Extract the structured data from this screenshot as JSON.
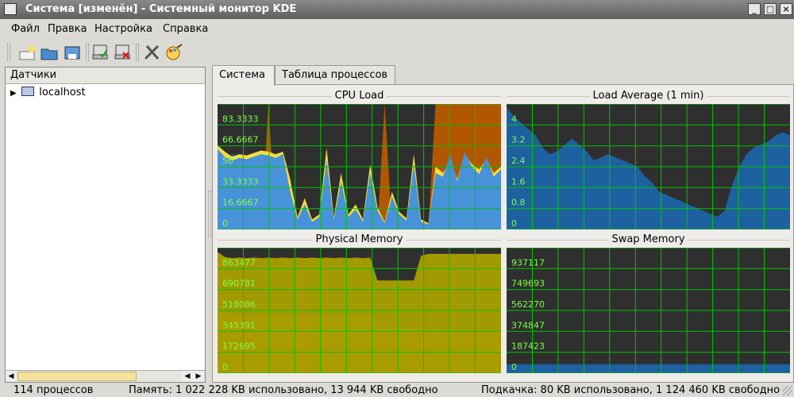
{
  "window": {
    "title": "Система [изменён] - Системный монитор KDE"
  },
  "menu": [
    "Файл",
    "Правка",
    "Настройка",
    "Справка"
  ],
  "toolbar_icons": [
    "new-sheet-icon",
    "open-icon",
    "save-icon",
    "connect-host-icon",
    "disconnect-host-icon",
    "configure-icon",
    "color-scheme-icon"
  ],
  "sidebar": {
    "header": "Датчики",
    "tree": [
      {
        "label": "localhost"
      }
    ]
  },
  "tabs": [
    "Система",
    "Таблица процессов"
  ],
  "colors": {
    "plot_bg": "#2f2f2f",
    "grid": "#00c400",
    "label": "#7dff44",
    "blue": "#1d64a8",
    "orange": "#b85a00",
    "olive": "#a8a000",
    "yellow": "#ffe63a",
    "lightblue": "#3d8de0"
  },
  "chart_data": [
    {
      "type": "area",
      "title": "CPU Load",
      "tick_labels": [
        "83.3333",
        "66.6667",
        "50",
        "33.3333",
        "16.6667",
        "0"
      ],
      "ylim": [
        0,
        100
      ],
      "grid": true,
      "series": [
        {
          "color": "#1d64a8",
          "values": [
            60,
            56,
            60,
            58,
            57,
            59,
            60,
            60,
            58,
            60,
            5,
            4,
            4,
            4,
            3,
            4,
            5,
            4,
            3,
            4,
            4,
            4,
            5,
            4,
            3,
            4,
            3,
            4,
            3,
            4,
            35,
            33,
            38,
            36,
            40,
            37,
            38,
            34,
            36,
            35
          ]
        },
        {
          "color": "#b85a00",
          "values": [
            0,
            0,
            0,
            0,
            0,
            0,
            0,
            100,
            0,
            0,
            0,
            0,
            0,
            0,
            0,
            0,
            0,
            0,
            0,
            0,
            0,
            0,
            0,
            100,
            0,
            0,
            0,
            0,
            0,
            0,
            100,
            100,
            100,
            100,
            100,
            100,
            100,
            100,
            100,
            100
          ]
        },
        {
          "color": "#ffe63a",
          "values": [
            67,
            62,
            58,
            60,
            59,
            61,
            63,
            62,
            60,
            62,
            40,
            10,
            25,
            8,
            12,
            65,
            10,
            45,
            12,
            20,
            8,
            52,
            18,
            6,
            30,
            14,
            9,
            60,
            8,
            5,
            50,
            45,
            55,
            40,
            60,
            52,
            48,
            56,
            45,
            50
          ]
        },
        {
          "color": "#3d8de0",
          "values": [
            64,
            58,
            55,
            57,
            56,
            58,
            60,
            59,
            57,
            60,
            30,
            8,
            20,
            6,
            10,
            55,
            8,
            38,
            10,
            16,
            6,
            45,
            15,
            5,
            26,
            12,
            7,
            52,
            6,
            4,
            45,
            42,
            60,
            38,
            62,
            50,
            44,
            58,
            42,
            48
          ]
        }
      ]
    },
    {
      "type": "area",
      "title": "Load Average (1 min)",
      "tick_labels": [
        "4",
        "3.2",
        "2.4",
        "1.6",
        "0.8",
        "0"
      ],
      "ylim": [
        0,
        4
      ],
      "grid": true,
      "series": [
        {
          "color": "#1d64a8",
          "values": [
            3.9,
            3.6,
            3.4,
            3.2,
            3.0,
            2.6,
            2.4,
            2.5,
            2.7,
            2.9,
            2.7,
            2.5,
            2.2,
            2.3,
            2.4,
            2.3,
            2.2,
            2.1,
            2.0,
            1.7,
            1.5,
            1.2,
            1.1,
            1.0,
            0.9,
            0.8,
            0.7,
            0.6,
            0.5,
            0.4,
            0.6,
            1.4,
            2.0,
            2.4,
            2.6,
            2.7,
            2.8,
            3.0,
            3.1,
            3.0
          ]
        }
      ]
    },
    {
      "type": "area",
      "title": "Physical Memory",
      "tick_labels": [
        "863477",
        "690781",
        "518086",
        "345391",
        "172695",
        "0"
      ],
      "ylim": [
        0,
        1036173
      ],
      "grid": true,
      "series": [
        {
          "color": "#1d64a8",
          "values": [
            200000,
            195000,
            190000,
            185000,
            180000,
            178000,
            176000,
            175000,
            174000,
            173000,
            172000,
            172000,
            171000,
            171000,
            170000,
            170000,
            170000,
            169000,
            169000,
            168000,
            168000,
            168000,
            167000,
            167000,
            167000,
            166000,
            166000,
            166000,
            165000,
            165000,
            165000,
            165000,
            165000,
            164000,
            164000,
            164000,
            164000,
            164000,
            164000,
            164000
          ]
        },
        {
          "color": "#b85a00",
          "values": [
            500000,
            495000,
            490000,
            485000,
            480000,
            478000,
            476000,
            475000,
            474000,
            473000,
            472000,
            471000,
            470000,
            469000,
            468000,
            467000,
            466000,
            465000,
            464000,
            463000,
            462000,
            480000,
            385000,
            380000,
            378000,
            376000,
            374000,
            372000,
            380000,
            375000,
            370000,
            368000,
            366000,
            365000,
            364000,
            363000,
            362000,
            361000,
            360000,
            359000
          ]
        },
        {
          "color": "#a8a000",
          "values": [
            1000000,
            960000,
            950000,
            955000,
            950000,
            955000,
            950000,
            955000,
            950000,
            955000,
            950000,
            955000,
            950000,
            955000,
            950000,
            955000,
            950000,
            955000,
            950000,
            955000,
            950000,
            955000,
            765000,
            765000,
            765000,
            765000,
            765000,
            765000,
            970000,
            985000,
            985000,
            985000,
            985000,
            985000,
            985000,
            985000,
            985000,
            985000,
            985000,
            985000
          ]
        }
      ]
    },
    {
      "type": "area",
      "title": "Swap Memory",
      "tick_labels": [
        "937117",
        "749693",
        "562270",
        "374847",
        "187423",
        "0"
      ],
      "ylim": [
        0,
        1124540
      ],
      "grid": true,
      "series": [
        {
          "color": "#1d64a8",
          "values": [
            80000,
            80000,
            80000,
            80000,
            80000,
            80000,
            80000,
            80000,
            80000,
            80000,
            80000,
            80000,
            80000,
            80000,
            80000,
            80000,
            80000,
            80000,
            80000,
            80000,
            80000,
            80000,
            80000,
            80000,
            80000,
            80000,
            80000,
            80000,
            80000,
            80000,
            80000,
            80000,
            80000,
            80000,
            80000,
            80000,
            80000,
            80000,
            80000,
            80000
          ]
        }
      ]
    }
  ],
  "status": {
    "processes": "114 процессов",
    "memory": "Память: 1 022 228 KB использовано, 13 944 KB свободно",
    "swap": "Подкачка: 80 KB использовано, 1 124 460 KB свободно"
  }
}
